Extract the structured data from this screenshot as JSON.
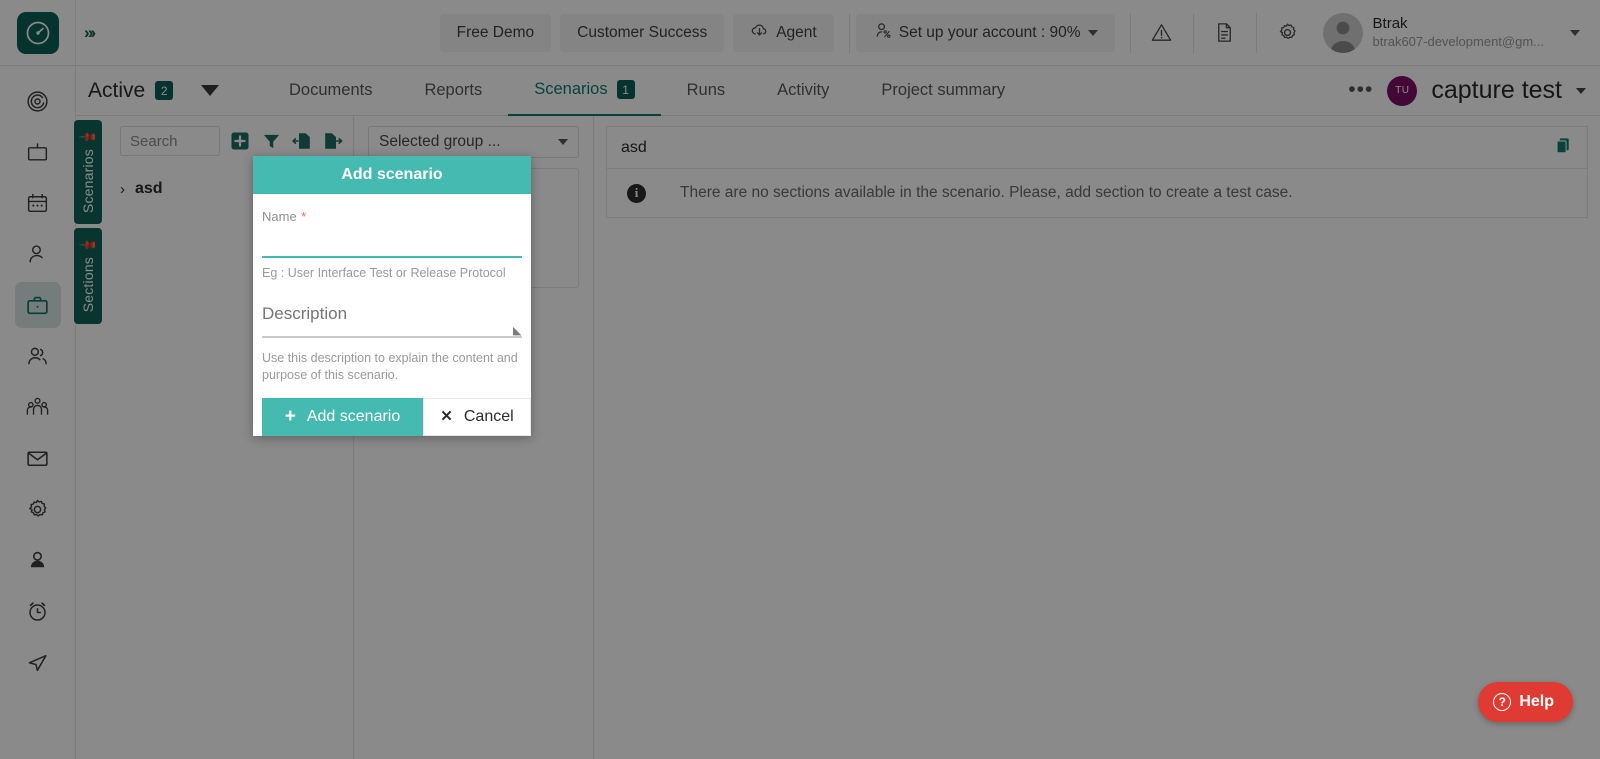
{
  "header": {
    "logo_icon": "speedometer-logo-icon",
    "expander_icon": "double-chevron-right-icon",
    "buttons": [
      {
        "label": "Free Demo",
        "icon": null
      },
      {
        "label": "Customer Success",
        "icon": null
      },
      {
        "label": "Agent",
        "icon": "cloud-download-icon"
      }
    ],
    "account_setup": {
      "label": "Set up your account : 90%",
      "icon": "account-person-icon"
    },
    "icons": [
      {
        "name": "warning-triangle-icon"
      },
      {
        "name": "document-icon"
      },
      {
        "name": "gear-icon"
      }
    ],
    "user": {
      "name": "Btrak",
      "email": "btrak607-development@gm...",
      "avatar_icon": "user-avatar-icon"
    }
  },
  "rail": {
    "items": [
      {
        "name": "target-icon",
        "active": false
      },
      {
        "name": "tv-icon",
        "active": false
      },
      {
        "name": "calendar-icon",
        "active": false
      },
      {
        "name": "person-icon",
        "active": false
      },
      {
        "name": "briefcase-icon",
        "active": true
      },
      {
        "name": "people-icon",
        "active": false
      },
      {
        "name": "group-icon",
        "active": false
      },
      {
        "name": "mail-icon",
        "active": false
      },
      {
        "name": "settings-gear-icon",
        "active": false
      },
      {
        "name": "user-profile-icon",
        "active": false
      },
      {
        "name": "alarm-clock-icon",
        "active": false
      },
      {
        "name": "send-icon",
        "active": false
      }
    ]
  },
  "tabbar": {
    "filter": {
      "label": "Active",
      "count": "2"
    },
    "tabs": [
      {
        "label": "Documents",
        "count": null,
        "selected": false
      },
      {
        "label": "Reports",
        "count": null,
        "selected": false
      },
      {
        "label": "Scenarios",
        "count": "1",
        "selected": true
      },
      {
        "label": "Runs",
        "count": null,
        "selected": false
      },
      {
        "label": "Activity",
        "count": null,
        "selected": false
      },
      {
        "label": "Project summary",
        "count": null,
        "selected": false
      }
    ],
    "more_label": "•••",
    "project": {
      "initials": "TU",
      "name": "capture test"
    }
  },
  "side_tabs": [
    {
      "label": "Scenarios",
      "pin_icon": "pin-icon"
    },
    {
      "label": "Sections",
      "pin_icon": "pin-icon"
    }
  ],
  "list_panel": {
    "search": {
      "value": "",
      "placeholder": "Search"
    },
    "toolbar_icons": [
      {
        "name": "add-square-icon"
      },
      {
        "name": "filter-funnel-icon"
      },
      {
        "name": "import-icon"
      },
      {
        "name": "export-icon"
      }
    ],
    "rows": [
      {
        "label": "asd",
        "chevron": "›"
      }
    ]
  },
  "group_panel": {
    "select": {
      "value": "Selected group ...",
      "caret_icon": "chevron-down-icon"
    },
    "card_text": ""
  },
  "content": {
    "title": "asd",
    "copy_icon": "copy-document-icon",
    "alert": {
      "icon": "info-icon",
      "icon_glyph": "i",
      "text": "There are no sections available in the scenario. Please, add section to create a test case."
    }
  },
  "modal": {
    "title": "Add scenario",
    "name_field": {
      "label": "Name",
      "required_marker": "*",
      "value": "",
      "placeholder": "",
      "hint": "Eg : User Interface Test or Release Protocol"
    },
    "description_field": {
      "label": "Description",
      "value": "",
      "placeholder": "Description",
      "hint": "Use this description to explain the content and purpose of this scenario.",
      "resize_icon": "resize-grip-icon"
    },
    "submit_button": {
      "label": "Add scenario",
      "icon": "plus-icon",
      "glyph": "+"
    },
    "cancel_button": {
      "label": "Cancel",
      "icon": "close-x-icon",
      "glyph": "✕"
    }
  },
  "help": {
    "label": "Help",
    "icon": "question-mark-icon",
    "glyph": "?"
  },
  "colors": {
    "brand_dark": "#0b5f53",
    "brand_teal": "#45bab0",
    "accent_teal": "#0f7d6d",
    "avatar_purple": "#7c0f63",
    "help_red": "#e03b32",
    "required_red": "#f06a5a"
  }
}
